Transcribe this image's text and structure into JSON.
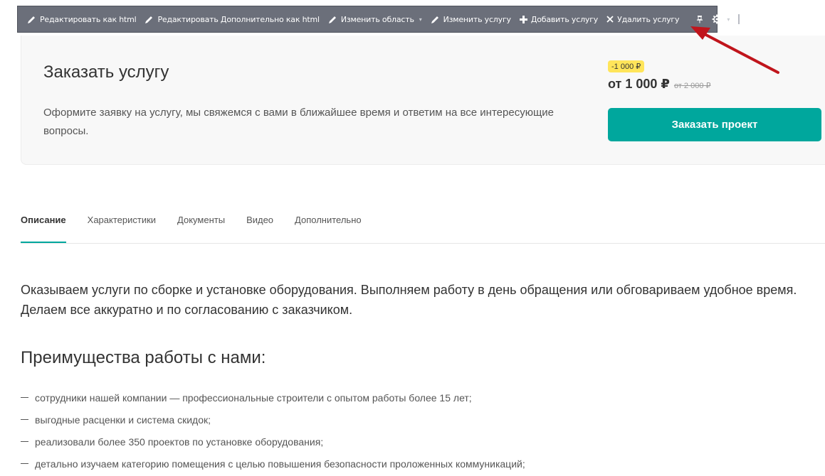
{
  "toolbar": {
    "edit_html": "Редактировать как html",
    "edit_extra_html": "Редактировать Дополнительно как html",
    "change_area": "Изменить область",
    "change_service": "Изменить услугу",
    "add_service": "Добавить услугу",
    "delete_service": "Удалить услугу",
    "icons": [
      "pencil-icon",
      "plus-icon",
      "close-icon",
      "pin-icon",
      "gear-icon",
      "chevron-down-icon"
    ]
  },
  "order": {
    "title": "Заказать услугу",
    "description": "Оформите заявку на услугу, мы свяжемся с вами в ближайшее время и ответим на все интересующие вопросы.",
    "discount": "-1 000 ₽",
    "price": "от 1 000 ₽",
    "old_price": "от 2 000 ₽",
    "button": "Заказать проект"
  },
  "tabs": [
    {
      "label": "Описание",
      "active": true
    },
    {
      "label": "Характеристики",
      "active": false
    },
    {
      "label": "Документы",
      "active": false
    },
    {
      "label": "Видео",
      "active": false
    },
    {
      "label": "Дополнительно",
      "active": false
    }
  ],
  "content": {
    "intro": "Оказываем услуги по сборке и установке оборудования. Выполняем работу в день обращения или обговариваем удобное время. Делаем все аккуратно и по согласованию с заказчиком.",
    "advantages_heading": "Преимущества работы с нами:",
    "advantages": [
      "сотрудники нашей компании — профессиональные строители с опытом работы более 15 лет;",
      "выгодные расценки и система скидок;",
      "реализовали более 350 проектов по установке оборудования;",
      "детально изучаем категорию помещения с целью повышения безопасности проложенных коммуникаций;"
    ]
  },
  "colors": {
    "accent": "#00a79d",
    "toolbar_bg": "#6b6f7a",
    "badge_bg": "#ffe55a",
    "annotation_arrow": "#c0151c"
  }
}
